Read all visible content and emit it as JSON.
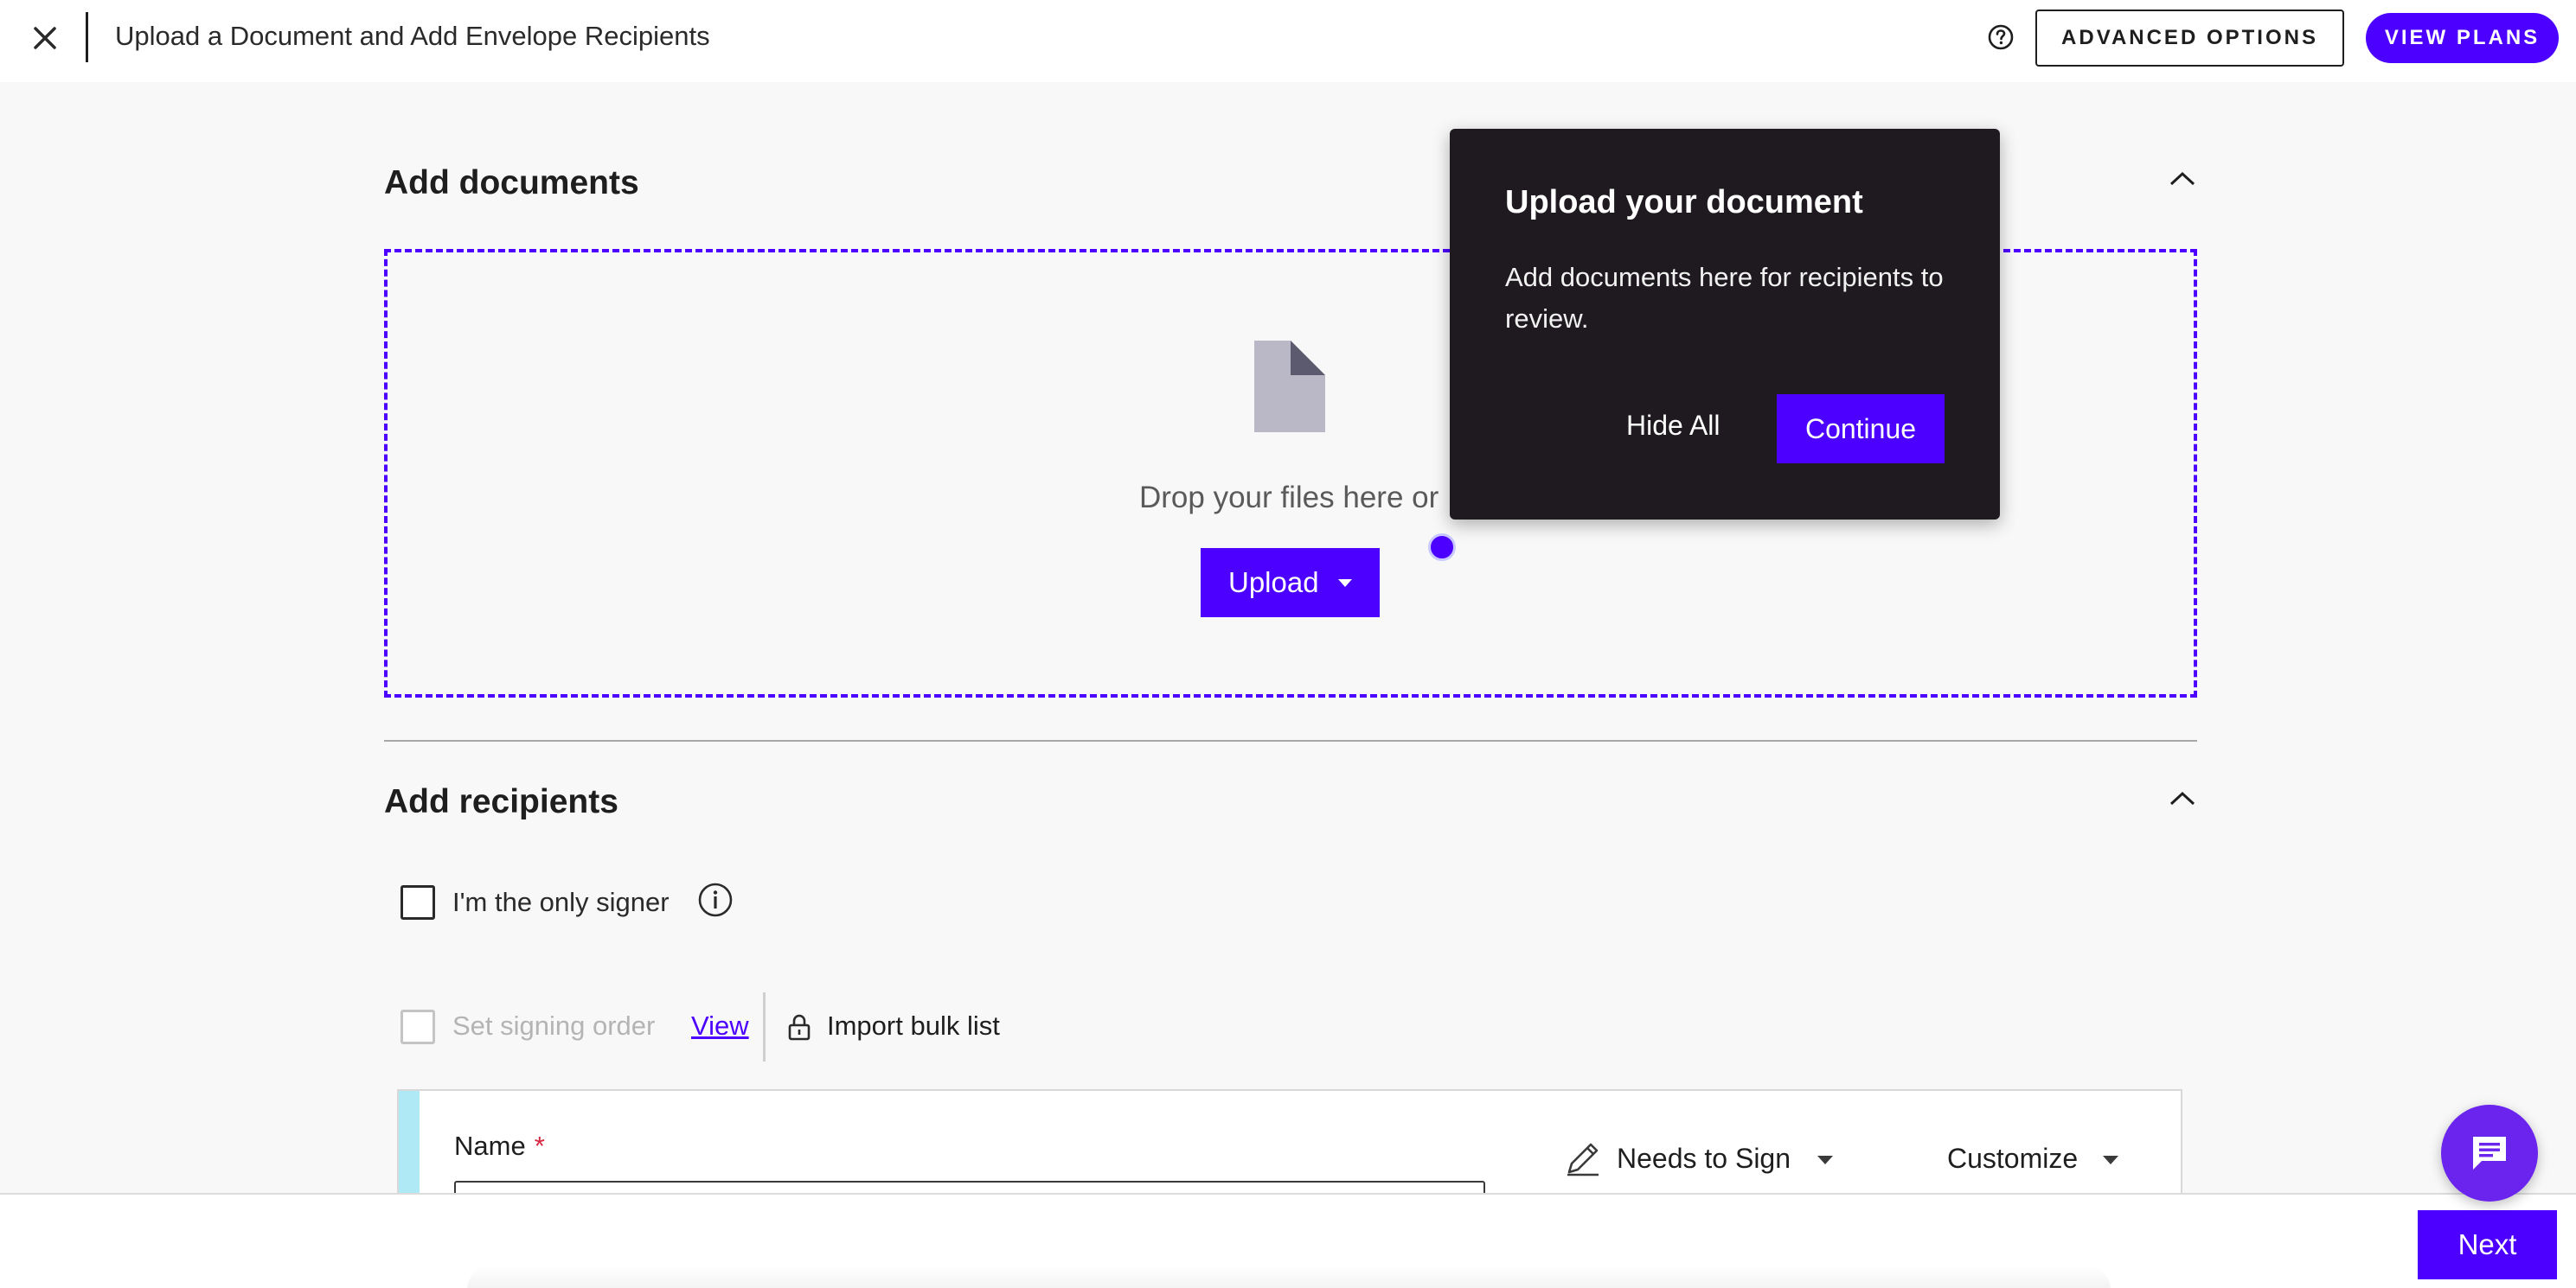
{
  "header": {
    "title": "Upload a Document and Add Envelope Recipients",
    "close_icon": "close-icon",
    "help_icon": "help-circle-icon",
    "advanced_options_label": "ADVANCED OPTIONS",
    "view_plans_label": "VIEW PLANS"
  },
  "documents": {
    "title": "Add documents",
    "drop_text": "Drop your files here or",
    "upload_label": "Upload"
  },
  "recipients": {
    "title": "Add recipients",
    "only_signer_label": "I'm the only signer",
    "signing_order_label": "Set signing order",
    "view_link": "View",
    "import_bulk_label": "Import bulk list",
    "name_label": "Name",
    "required_marker": "*",
    "role_label": "Needs to Sign",
    "customize_label": "Customize"
  },
  "footer": {
    "next_label": "Next"
  },
  "popover": {
    "title": "Upload your document",
    "body": "Add documents here for recipients to review.",
    "hide_all_label": "Hide All",
    "continue_label": "Continue"
  },
  "colors": {
    "accent": "#4c00ff",
    "popover_bg": "#1e1a1f",
    "card_accent": "#aee9f5",
    "required": "#d7263d"
  }
}
